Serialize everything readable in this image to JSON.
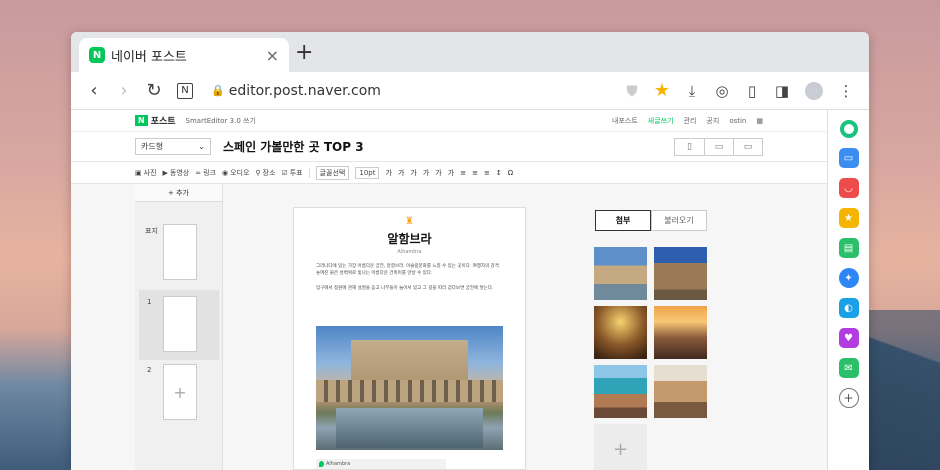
{
  "browser": {
    "tab_title": "네이버 포스트",
    "tab_icon": "N",
    "url": "editor.post.naver.com"
  },
  "editor": {
    "logo": "N",
    "brand": "포스트",
    "version": "SmartEditor 3.0 쓰기",
    "top_links": [
      "내포스트",
      "새글쓰기",
      "관리",
      "공지",
      "ostin"
    ],
    "template_select": "카드형",
    "doc_title": "스페인 가볼만한 곳 TOP 3",
    "toolbar_items": [
      "사진",
      "동영상",
      "링크",
      "오디오",
      "장소",
      "투표"
    ],
    "font_select": "글꼴선택",
    "font_size": "10pt",
    "format_buttons": [
      "가",
      "가",
      "가",
      "가",
      "가",
      "가"
    ],
    "add_page": "추가",
    "page_labels": [
      "표지",
      "1",
      "2"
    ]
  },
  "canvas": {
    "title": "알함브라",
    "subtitle": "Alhambra",
    "paragraph1": "그라나다에 있는 가장 아름다운 궁전, 알함브라. 이슬람문화를 느낄 수 있는 곳이다. 여행자의 감격 놓여진 붉은 성벽위로 빛나는 아름다운 건축미를 만날 수 있다.",
    "paragraph2": "입구에서 정원에 관해 설명을 듣고 나무들이 늘어서 있고 그 길을 따라 걷다보면 궁전에 닿는다.",
    "location": "Alhambra"
  },
  "attach": {
    "tab_attach": "첨부",
    "tab_load": "불러오기"
  }
}
